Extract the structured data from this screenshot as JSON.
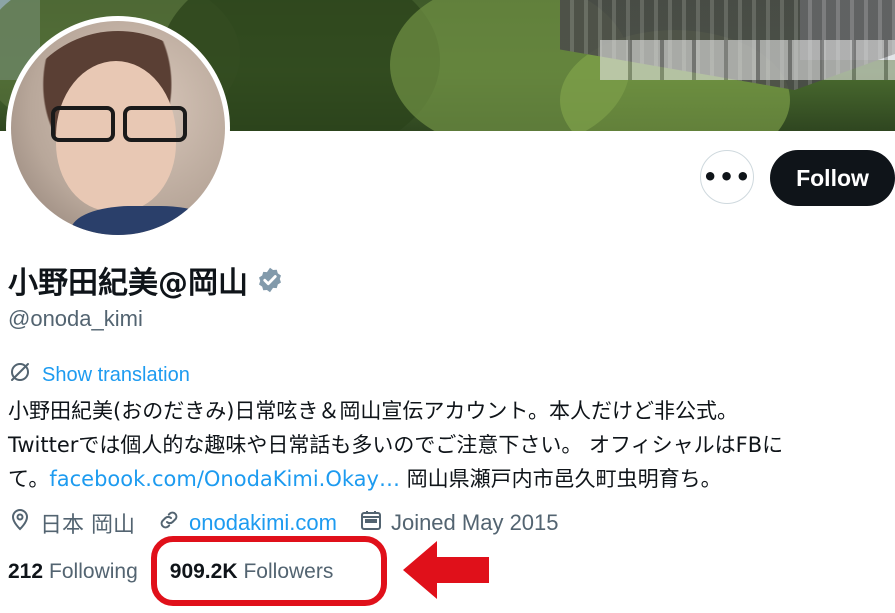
{
  "profile": {
    "display_name": "小野田紀美@岡山",
    "handle": "@onoda_kimi",
    "follow_label": "Follow",
    "more_label": "•••",
    "show_translation": "Show translation",
    "bio": {
      "line1": "小野田紀美(おのだきみ)日常呟き＆岡山宣伝アカウント。本人だけど非公式。",
      "line2": "Twitterでは個人的な趣味や日常話も多いのでご注意下さい。 オフィシャルはFBに",
      "line3_prefix": "て。",
      "link_text": "facebook.com/OnodaKimi.Okay…",
      "line3_suffix": " 岡山県瀬戸内市邑久町虫明育ち。"
    },
    "location": "日本 岡山",
    "website": "onodakimi.com",
    "joined": "Joined May 2015",
    "following_count": "212",
    "following_label": "Following",
    "followers_count": "909.2K",
    "followers_label": "Followers"
  },
  "colors": {
    "accent": "#1d9bf0",
    "highlight": "#e0101a",
    "text_secondary": "#536471"
  },
  "icons": [
    "verified-badge-icon",
    "translate-icon",
    "location-icon",
    "link-icon",
    "calendar-icon",
    "arrow-annotation"
  ]
}
